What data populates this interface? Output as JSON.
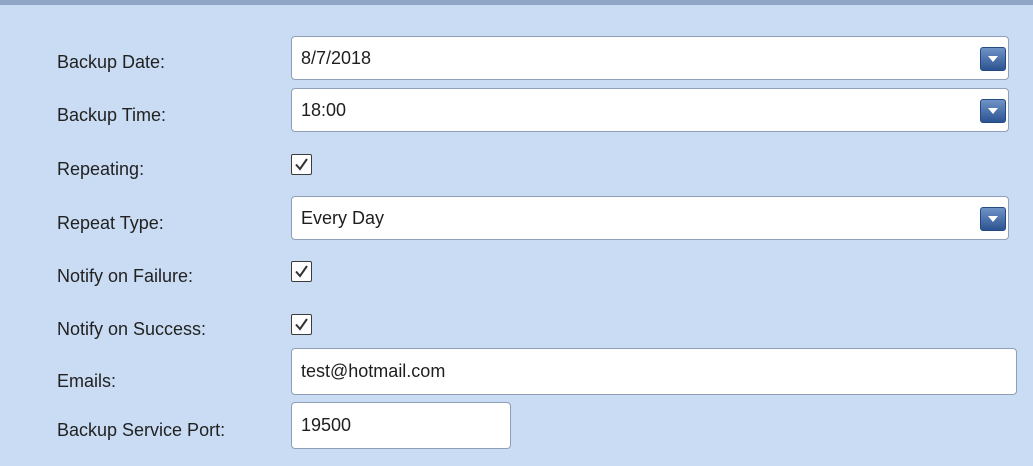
{
  "form": {
    "backup_date": {
      "label": "Backup Date:",
      "value": "8/7/2018",
      "icon": "chevron-down-icon"
    },
    "backup_time": {
      "label": "Backup Time:",
      "value": "18:00",
      "icon": "chevron-down-icon"
    },
    "repeating": {
      "label": "Repeating:",
      "checked": true
    },
    "repeat_type": {
      "label": "Repeat Type:",
      "value": "Every Day",
      "icon": "chevron-down-icon"
    },
    "notify_failure": {
      "label": "Notify on Failure:",
      "checked": true
    },
    "notify_success": {
      "label": "Notify on Success:",
      "checked": true
    },
    "emails": {
      "label": "Emails:",
      "value": "test@hotmail.com"
    },
    "service_port": {
      "label": "Backup Service Port:",
      "value": "19500"
    }
  },
  "colors": {
    "panel_background": "#c9dcf4",
    "dropdown_button": "#2c5492",
    "field_border": "#8e9fb7"
  }
}
